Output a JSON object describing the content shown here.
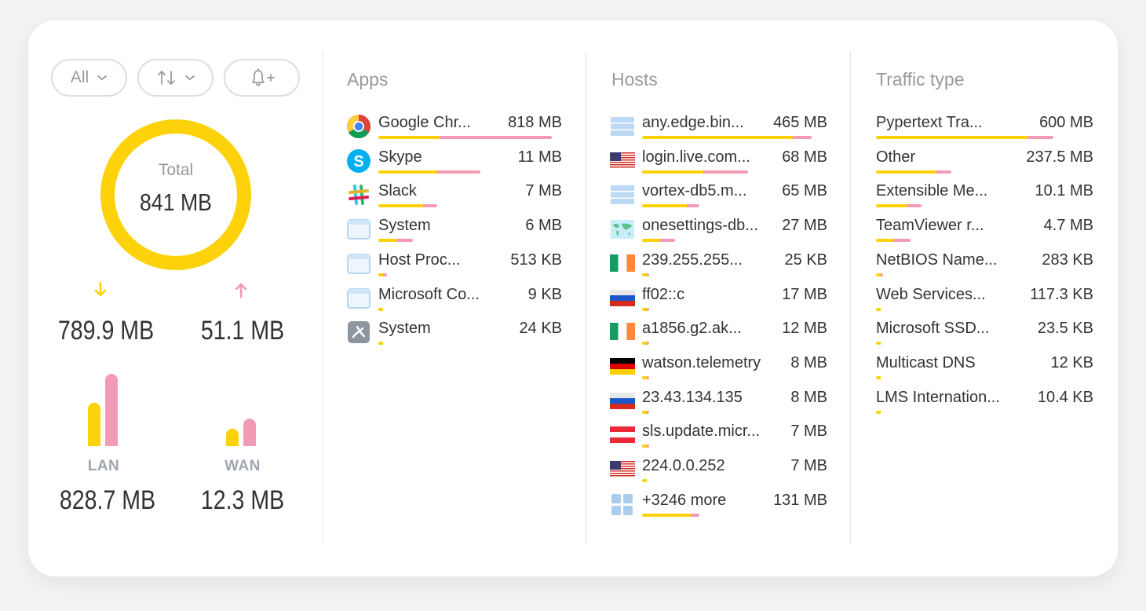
{
  "filters": {
    "scope_label": "All",
    "direction_icon": "up-down-arrows-icon",
    "alert_icon": "bell-plus-icon"
  },
  "summary": {
    "total_label": "Total",
    "total_value": "841 MB",
    "download_value": "789.9 MB",
    "upload_value": "51.1 MB",
    "lan_label": "LAN",
    "lan_value": "828.7 MB",
    "wan_label": "WAN",
    "wan_value": "12.3 MB",
    "lan_in_fraction": 0.6,
    "lan_out_fraction": 1.0,
    "wan_in_fraction": 0.24,
    "wan_out_fraction": 0.38
  },
  "colors": {
    "download": "#fdd20a",
    "upload": "#f39bb5"
  },
  "apps": {
    "title": "Apps",
    "items": [
      {
        "name": "Google Chr...",
        "value": "818 MB",
        "icon": "chrome-icon",
        "in": 0.3,
        "out": 0.55
      },
      {
        "name": "Skype",
        "value": "11 MB",
        "icon": "skype-icon",
        "in": 0.29,
        "out": 0.21
      },
      {
        "name": "Slack",
        "value": "7 MB",
        "icon": "slack-icon",
        "in": 0.22,
        "out": 0.07
      },
      {
        "name": "System",
        "value": "6 MB",
        "icon": "window-icon",
        "in": 0.09,
        "out": 0.08
      },
      {
        "name": "Host Proc...",
        "value": "513 KB",
        "icon": "window-icon",
        "in": 0.02,
        "out": 0.02
      },
      {
        "name": "Microsoft Co...",
        "value": "9 KB",
        "icon": "window-icon",
        "in": 0.01,
        "out": 0.0
      },
      {
        "name": "System",
        "value": "24 KB",
        "icon": "system-tray-icon",
        "in": 0.01,
        "out": 0.0
      }
    ]
  },
  "hosts": {
    "title": "Hosts",
    "items": [
      {
        "name": "any.edge.bin...",
        "value": "465 MB",
        "icon": "server-icon",
        "in": 0.74,
        "out": 0.09
      },
      {
        "name": "login.live.com...",
        "value": "68 MB",
        "icon": "flag-us-icon",
        "in": 0.3,
        "out": 0.22
      },
      {
        "name": "vortex-db5.m...",
        "value": "65 MB",
        "icon": "server-icon",
        "in": 0.22,
        "out": 0.06
      },
      {
        "name": "onesettings-db...",
        "value": "27 MB",
        "icon": "world-map-icon",
        "in": 0.09,
        "out": 0.07
      },
      {
        "name": "239.255.255...",
        "value": "25 KB",
        "icon": "flag-ie-icon",
        "in": 0.02,
        "out": 0.01
      },
      {
        "name": "ff02::c",
        "value": "17 MB",
        "icon": "flag-ru-icon",
        "in": 0.02,
        "out": 0.01
      },
      {
        "name": "a1856.g2.ak...",
        "value": "12 MB",
        "icon": "flag-ie-icon",
        "in": 0.02,
        "out": 0.01
      },
      {
        "name": "watson.telemetry",
        "value": "8 MB",
        "icon": "flag-de-icon",
        "in": 0.01,
        "out": 0.01
      },
      {
        "name": "23.43.134.135",
        "value": "8 MB",
        "icon": "flag-ru-icon",
        "in": 0.01,
        "out": 0.01
      },
      {
        "name": "sls.update.micr...",
        "value": "7 MB",
        "icon": "flag-at-icon",
        "in": 0.01,
        "out": 0.01
      },
      {
        "name": "224.0.0.252",
        "value": "7 MB",
        "icon": "flag-us-icon",
        "in": 0.01,
        "out": 0.0
      },
      {
        "name": "+3246 more",
        "value": "131 MB",
        "icon": "grid-icon",
        "in": 0.24,
        "out": 0.04
      }
    ]
  },
  "traffic": {
    "title": "Traffic type",
    "items": [
      {
        "name": "Pypertext Tra...",
        "value": "600 MB",
        "in": 0.7,
        "out": 0.12
      },
      {
        "name": "Other",
        "value": "237.5 MB",
        "in": 0.28,
        "out": 0.07
      },
      {
        "name": "Extensible Me...",
        "value": "10.1 MB",
        "in": 0.14,
        "out": 0.07
      },
      {
        "name": "TeamViewer r...",
        "value": "4.7 MB",
        "in": 0.08,
        "out": 0.08
      },
      {
        "name": "NetBIOS Name...",
        "value": "283 KB",
        "in": 0.02,
        "out": 0.01
      },
      {
        "name": "Web Services...",
        "value": "117.3 KB",
        "in": 0.01,
        "out": 0.0
      },
      {
        "name": "Microsoft SSD...",
        "value": "23.5 KB",
        "in": 0.01,
        "out": 0.0
      },
      {
        "name": "Multicast DNS",
        "value": "12 KB",
        "in": 0.01,
        "out": 0.0
      },
      {
        "name": "LMS Internation...",
        "value": "10.4 KB",
        "in": 0.01,
        "out": 0.0
      }
    ]
  }
}
